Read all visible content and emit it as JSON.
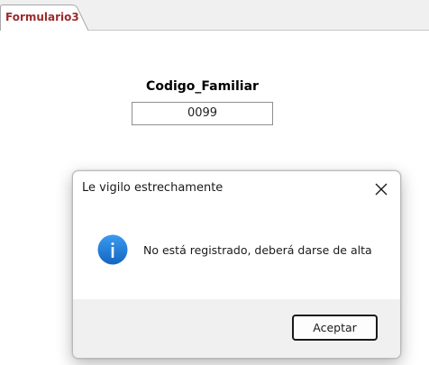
{
  "tabs": [
    {
      "label": "Formulario3"
    }
  ],
  "form": {
    "field_label": "Codigo_Familiar",
    "field_value": "0099"
  },
  "dialog": {
    "title": "Le vigilo estrechamente",
    "message": "No está registrado, deberá darse de alta",
    "ok_label": "Aceptar",
    "icon": "information-icon",
    "icon_color": "#1e78d2"
  }
}
